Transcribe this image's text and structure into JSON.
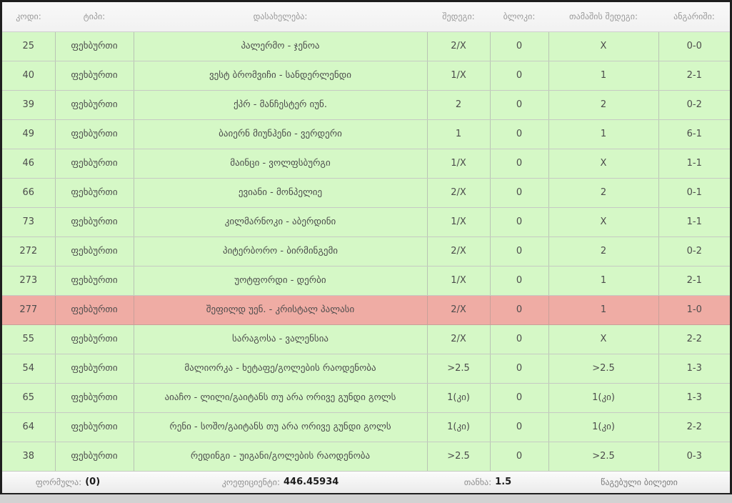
{
  "colors": {
    "row_green": "#d5f8c6",
    "row_red": "#efaca4",
    "frame": "#1f1f1f"
  },
  "table": {
    "headers": {
      "code": "კოდი:",
      "type": "ტიპი:",
      "name": "დასახელება:",
      "result": "შედეგი:",
      "block": "ბლოკი:",
      "game_result": "თამაშის შედეგი:",
      "score": "ანგარიში:"
    },
    "rows": [
      {
        "code": "25",
        "type": "ფეხბურთი",
        "name": "პალერმო - ჯენოა",
        "result": "2/X",
        "block": "0",
        "game_result": "X",
        "score": "0-0",
        "state": "green"
      },
      {
        "code": "40",
        "type": "ფეხბურთი",
        "name": "ვესტ ბრომვიჩი - სანდერლენდი",
        "result": "1/X",
        "block": "0",
        "game_result": "1",
        "score": "2-1",
        "state": "green"
      },
      {
        "code": "39",
        "type": "ფეხბურთი",
        "name": "ქპრ - მანჩესტერ იუნ.",
        "result": "2",
        "block": "0",
        "game_result": "2",
        "score": "0-2",
        "state": "green"
      },
      {
        "code": "49",
        "type": "ფეხბურთი",
        "name": "ბაიერნ მიუნჰენი - ვერდერი",
        "result": "1",
        "block": "0",
        "game_result": "1",
        "score": "6-1",
        "state": "green"
      },
      {
        "code": "46",
        "type": "ფეხბურთი",
        "name": "მაინცი - ვოლფსბურგი",
        "result": "1/X",
        "block": "0",
        "game_result": "X",
        "score": "1-1",
        "state": "green"
      },
      {
        "code": "66",
        "type": "ფეხბურთი",
        "name": "ევიანი - მონპელიე",
        "result": "2/X",
        "block": "0",
        "game_result": "2",
        "score": "0-1",
        "state": "green"
      },
      {
        "code": "73",
        "type": "ფეხბურთი",
        "name": "კილმარნოკი - აბერდინი",
        "result": "1/X",
        "block": "0",
        "game_result": "X",
        "score": "1-1",
        "state": "green"
      },
      {
        "code": "272",
        "type": "ფეხბურთი",
        "name": "პიტერბორო - ბირმინგემი",
        "result": "2/X",
        "block": "0",
        "game_result": "2",
        "score": "0-2",
        "state": "green"
      },
      {
        "code": "273",
        "type": "ფეხბურთი",
        "name": "უოტფორდი - დერბი",
        "result": "1/X",
        "block": "0",
        "game_result": "1",
        "score": "2-1",
        "state": "green"
      },
      {
        "code": "277",
        "type": "ფეხბურთი",
        "name": "შეფილდ უენ. - კრისტალ პალასი",
        "result": "2/X",
        "block": "0",
        "game_result": "1",
        "score": "1-0",
        "state": "red"
      },
      {
        "code": "55",
        "type": "ფეხბურთი",
        "name": "სარაგოსა - ვალენსია",
        "result": "2/X",
        "block": "0",
        "game_result": "X",
        "score": "2-2",
        "state": "green"
      },
      {
        "code": "54",
        "type": "ფეხბურთი",
        "name": "მალიორკა - ხეტაფე/გოლების რაოდენობა",
        "result": ">2.5",
        "block": "0",
        "game_result": ">2.5",
        "score": "1-3",
        "state": "green"
      },
      {
        "code": "65",
        "type": "ფეხბურთი",
        "name": "აიაჩო - ლილი/გაიტანს თუ არა ორივე გუნდი გოლს",
        "result": "1(კი)",
        "block": "0",
        "game_result": "1(კი)",
        "score": "1-3",
        "state": "green"
      },
      {
        "code": "64",
        "type": "ფეხბურთი",
        "name": "რენი - სოშო/გაიტანს თუ არა ორივე გუნდი გოლს",
        "result": "1(კი)",
        "block": "0",
        "game_result": "1(კი)",
        "score": "2-2",
        "state": "green"
      },
      {
        "code": "38",
        "type": "ფეხბურთი",
        "name": "რედინგი - უიგანი/გოლების რაოდენობა",
        "result": ">2.5",
        "block": "0",
        "game_result": ">2.5",
        "score": "0-3",
        "state": "green"
      }
    ]
  },
  "footer": {
    "formula_label": "ფორმულა:",
    "formula_value": "(0)",
    "coefficient_label": "კოეფიციენტი:",
    "coefficient_value": "446.45934",
    "amount_label": "თანხა:",
    "amount_value": "1.5",
    "status": "წაგებული ბილეთი"
  }
}
